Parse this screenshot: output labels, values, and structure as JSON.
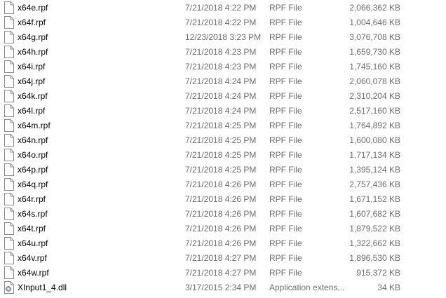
{
  "files": [
    {
      "name": "x64e.rpf",
      "date": "7/21/2018 4:22 PM",
      "type": "RPF File",
      "size": "2,066,362 KB",
      "icon": "document-icon"
    },
    {
      "name": "x64f.rpf",
      "date": "7/21/2018 4:22 PM",
      "type": "RPF File",
      "size": "1,004,646 KB",
      "icon": "document-icon"
    },
    {
      "name": "x64g.rpf",
      "date": "12/23/2018 3:23 PM",
      "type": "RPF File",
      "size": "3,076,708 KB",
      "icon": "document-icon"
    },
    {
      "name": "x64h.rpf",
      "date": "7/21/2018 4:23 PM",
      "type": "RPF File",
      "size": "1,659,730 KB",
      "icon": "document-icon"
    },
    {
      "name": "x64i.rpf",
      "date": "7/21/2018 4:23 PM",
      "type": "RPF File",
      "size": "1,745,160 KB",
      "icon": "document-icon"
    },
    {
      "name": "x64j.rpf",
      "date": "7/21/2018 4:24 PM",
      "type": "RPF File",
      "size": "2,060,078 KB",
      "icon": "document-icon"
    },
    {
      "name": "x64k.rpf",
      "date": "7/21/2018 4:24 PM",
      "type": "RPF File",
      "size": "2,310,204 KB",
      "icon": "document-icon"
    },
    {
      "name": "x64l.rpf",
      "date": "7/21/2018 4:24 PM",
      "type": "RPF File",
      "size": "2,517,160 KB",
      "icon": "document-icon"
    },
    {
      "name": "x64m.rpf",
      "date": "7/21/2018 4:25 PM",
      "type": "RPF File",
      "size": "1,764,892 KB",
      "icon": "document-icon"
    },
    {
      "name": "x64n.rpf",
      "date": "7/21/2018 4:25 PM",
      "type": "RPF File",
      "size": "1,600,080 KB",
      "icon": "document-icon"
    },
    {
      "name": "x64o.rpf",
      "date": "7/21/2018 4:25 PM",
      "type": "RPF File",
      "size": "1,717,134 KB",
      "icon": "document-icon"
    },
    {
      "name": "x64p.rpf",
      "date": "7/21/2018 4:25 PM",
      "type": "RPF File",
      "size": "1,395,124 KB",
      "icon": "document-icon"
    },
    {
      "name": "x64q.rpf",
      "date": "7/21/2018 4:26 PM",
      "type": "RPF File",
      "size": "2,757,436 KB",
      "icon": "document-icon"
    },
    {
      "name": "x64r.rpf",
      "date": "7/21/2018 4:26 PM",
      "type": "RPF File",
      "size": "1,671,152 KB",
      "icon": "document-icon"
    },
    {
      "name": "x64s.rpf",
      "date": "7/21/2018 4:26 PM",
      "type": "RPF File",
      "size": "1,607,682 KB",
      "icon": "document-icon"
    },
    {
      "name": "x64t.rpf",
      "date": "7/21/2018 4:26 PM",
      "type": "RPF File",
      "size": "1,879,522 KB",
      "icon": "document-icon"
    },
    {
      "name": "x64u.rpf",
      "date": "7/21/2018 4:26 PM",
      "type": "RPF File",
      "size": "1,322,662 KB",
      "icon": "document-icon"
    },
    {
      "name": "x64v.rpf",
      "date": "7/21/2018 4:27 PM",
      "type": "RPF File",
      "size": "1,896,530 KB",
      "icon": "document-icon"
    },
    {
      "name": "x64w.rpf",
      "date": "7/21/2018 4:27 PM",
      "type": "RPF File",
      "size": "915,372 KB",
      "icon": "document-icon"
    },
    {
      "name": "XInput1_4.dll",
      "date": "3/17/2015 2:34 PM",
      "type": "Application extens...",
      "size": "34 KB",
      "icon": "dll-gear-icon"
    }
  ]
}
